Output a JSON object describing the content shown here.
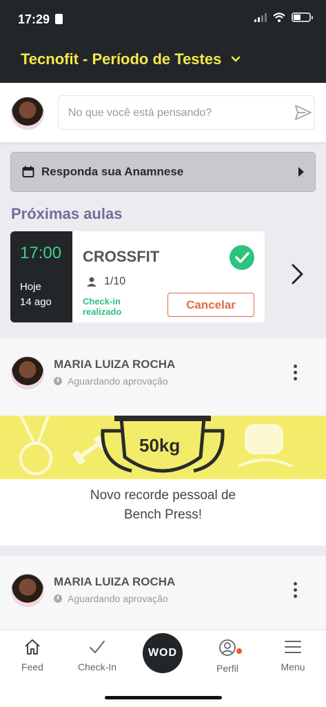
{
  "status_bar": {
    "time": "17:29"
  },
  "header": {
    "title": "Tecnofit - Período de Testes"
  },
  "composer": {
    "placeholder": "No que você está pensando?"
  },
  "anamnese": {
    "label": "Responda sua Anamnese"
  },
  "upcoming": {
    "title": "Próximas aulas",
    "class": {
      "time": "17:00",
      "day": "Hoje",
      "date": "14 ago",
      "name": "CROSSFIT",
      "capacity": "1/10",
      "checkin_status": "Check-in realizado",
      "cancel_label": "Cancelar"
    }
  },
  "posts": [
    {
      "author": "MARIA LUIZA ROCHA",
      "status": "Aguardando aprovação",
      "banner_value": "50kg",
      "caption_line1": "Novo recorde pessoal de",
      "caption_line2": "Bench Press!"
    },
    {
      "author": "MARIA LUIZA ROCHA",
      "status": "Aguardando aprovação"
    }
  ],
  "nav": {
    "feed": "Feed",
    "checkin": "Check-In",
    "wod": "WOD",
    "profile": "Perfil",
    "menu": "Menu"
  },
  "colors": {
    "dark": "#232629",
    "accent_yellow": "#f3e84a",
    "success_green": "#2ec27e",
    "cancel_orange": "#e06c42",
    "section_purple": "#6f6f99"
  }
}
